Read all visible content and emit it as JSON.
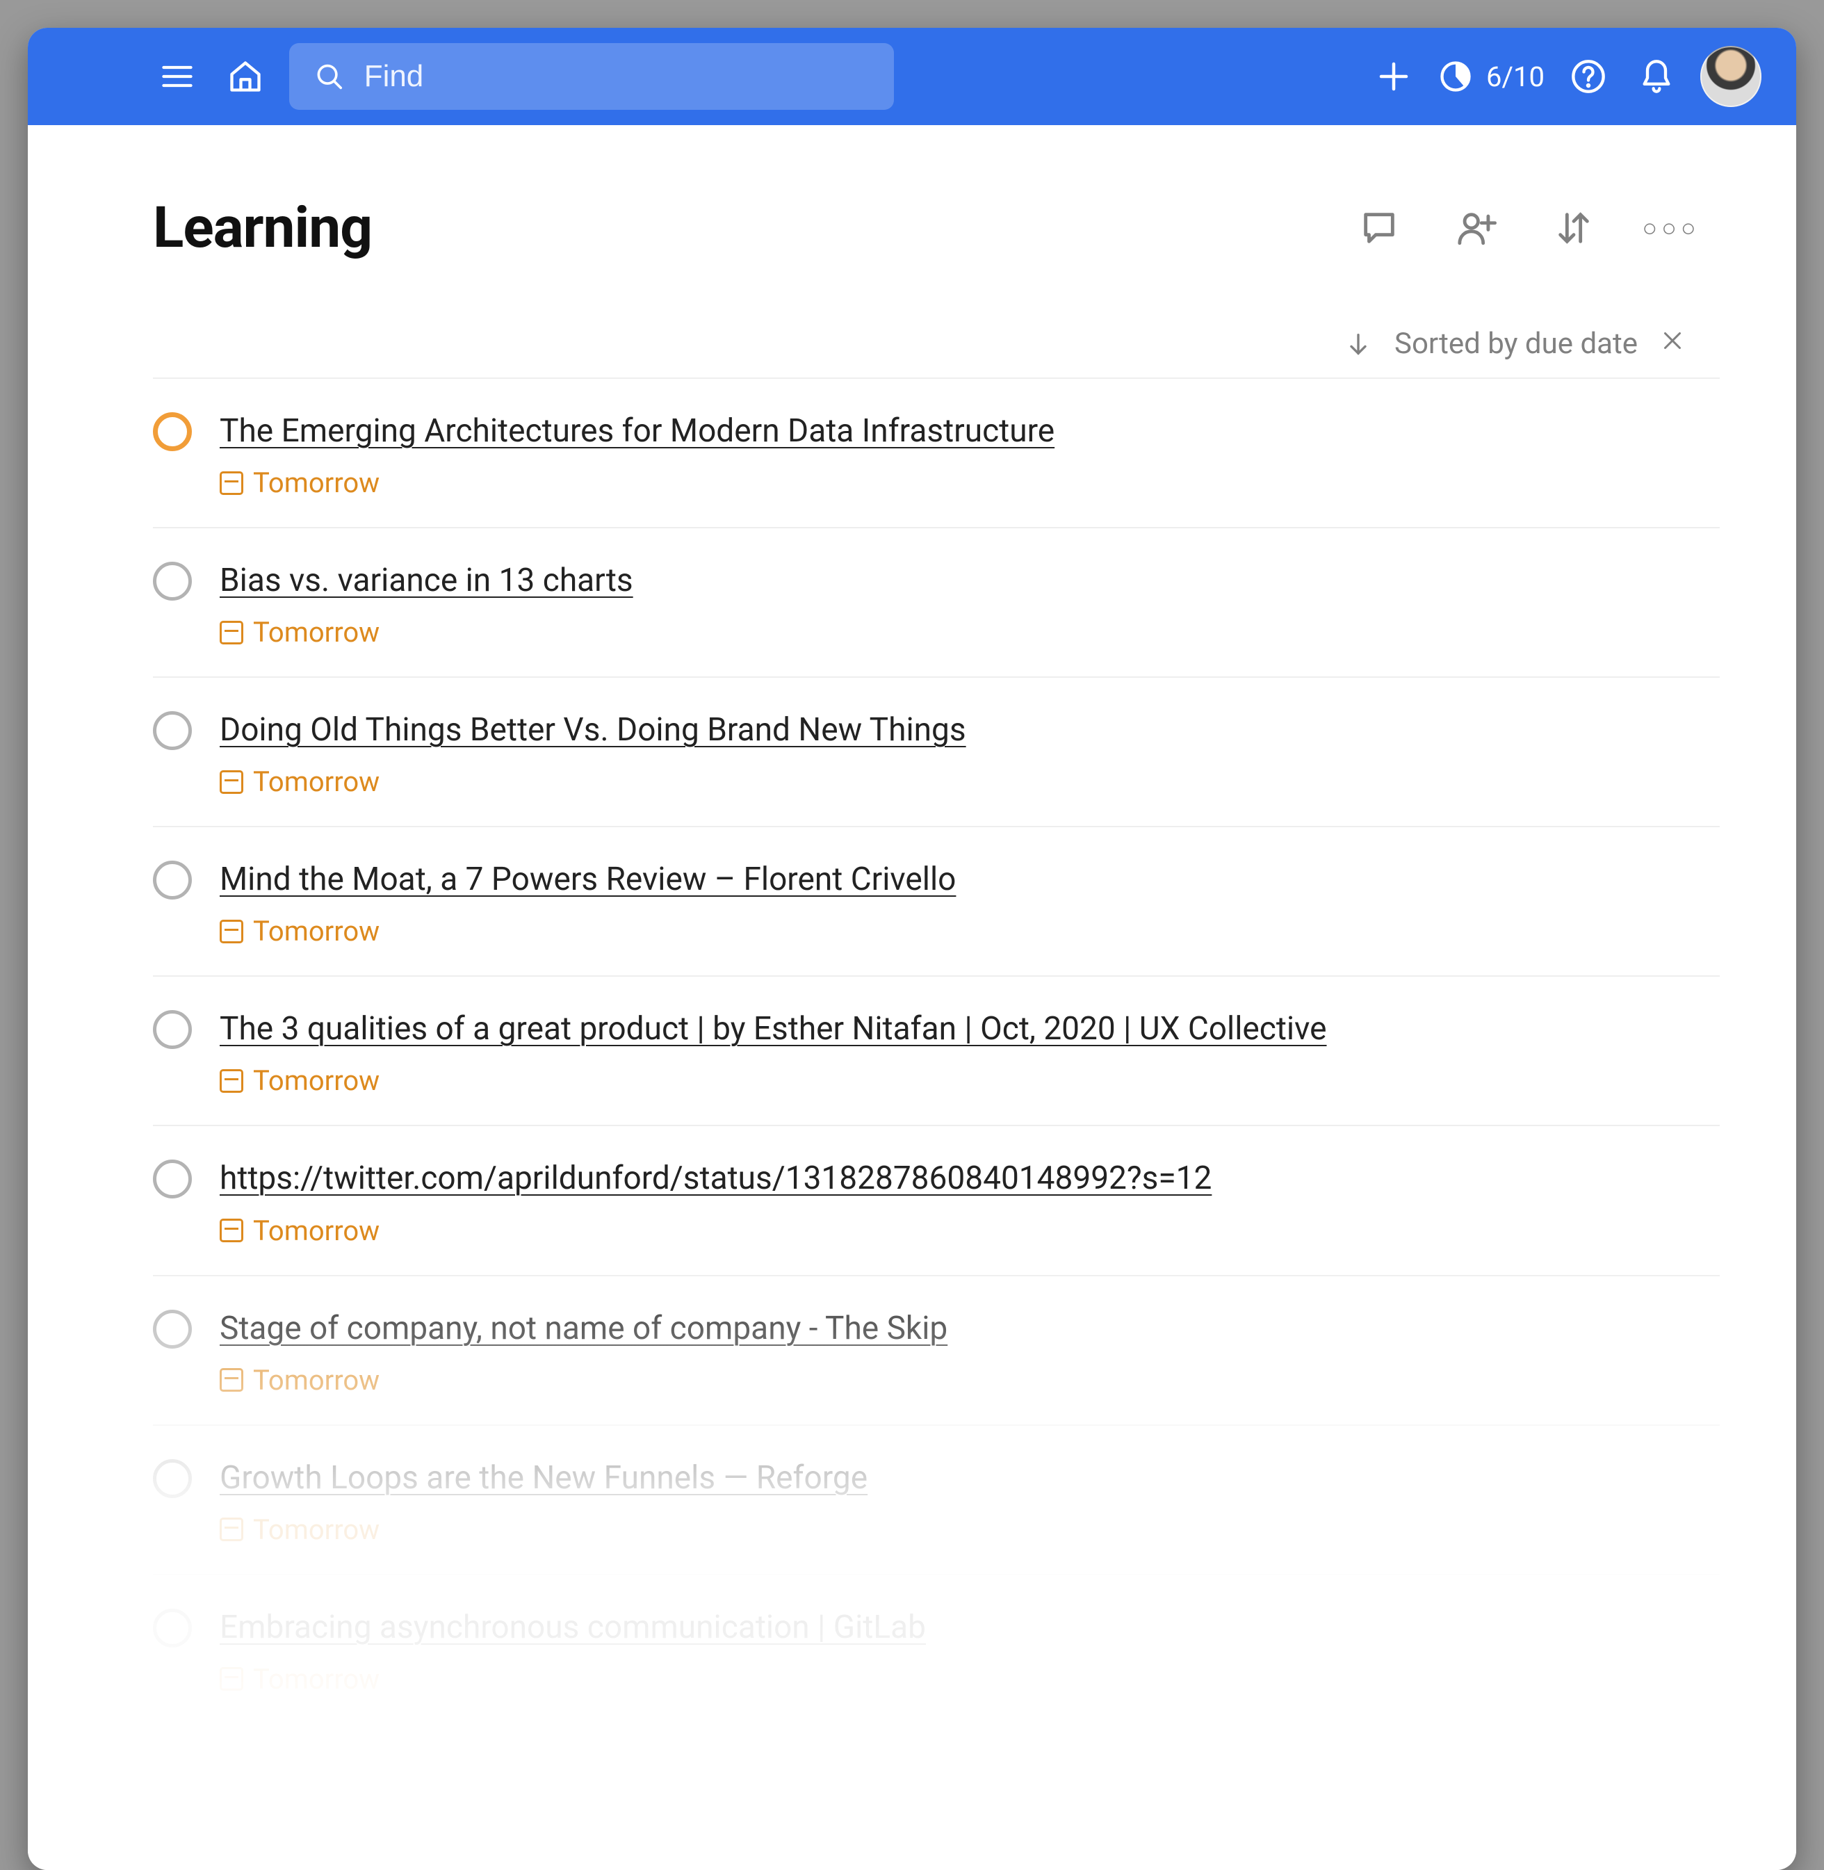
{
  "topbar": {
    "search_placeholder": "Find",
    "progress_text": "6/10"
  },
  "project": {
    "title": "Learning"
  },
  "sortbar": {
    "label": "Sorted by due date"
  },
  "tasks": [
    {
      "title": "The Emerging Architectures for Modern Data Infrastructure",
      "due": "Tomorrow",
      "priority": true
    },
    {
      "title": "Bias vs. variance in 13 charts",
      "due": "Tomorrow",
      "priority": false
    },
    {
      "title": "Doing Old Things Better Vs. Doing Brand New Things",
      "due": "Tomorrow",
      "priority": false
    },
    {
      "title": "Mind the Moat, a 7 Powers Review – Florent Crivello",
      "due": "Tomorrow",
      "priority": false
    },
    {
      "title": "The 3 qualities of a great product | by Esther Nitafan | Oct, 2020 | UX Collective",
      "due": "Tomorrow",
      "priority": false
    },
    {
      "title": "https://twitter.com/aprildunford/status/1318287860840148992?s=12",
      "due": "Tomorrow",
      "priority": false
    },
    {
      "title": "Stage of company, not name of company - The Skip",
      "due": "Tomorrow",
      "priority": false
    },
    {
      "title": "Growth Loops are the New Funnels — Reforge",
      "due": "Tomorrow",
      "priority": false
    },
    {
      "title": "Embracing asynchronous communication | GitLab",
      "due": "Tomorrow",
      "priority": false
    }
  ]
}
